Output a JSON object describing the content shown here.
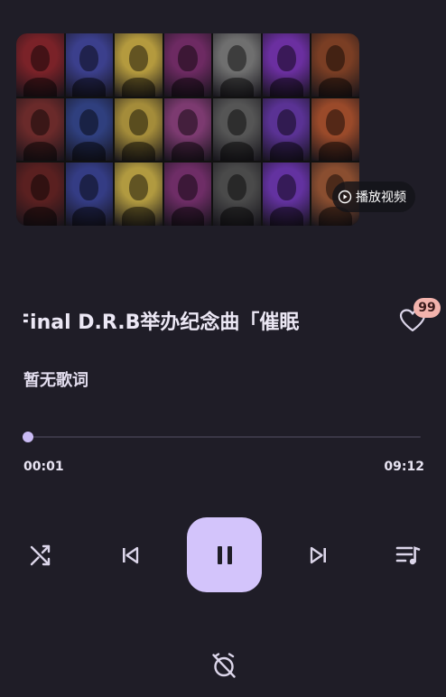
{
  "player": {
    "video_button_label": "播放视频",
    "song_title": "Final D.R.B举办纪念曲「催眠",
    "like_count": "99",
    "lyric_text": "暂无歌词",
    "progress_fraction": 0.002,
    "time_current": "00:01",
    "time_total": "09:12"
  },
  "cover_tiles": [
    "#7a2228",
    "#3b3f8c",
    "#b49a3e",
    "#6d2a62",
    "#6f6f6f",
    "#6b2fa0",
    "#7a3e24",
    "#6a2a2a",
    "#2f3f7e",
    "#a48c3a",
    "#7c3a70",
    "#555555",
    "#5a3294",
    "#9a4a2a",
    "#5a2020",
    "#343c84",
    "#b19a40",
    "#6e2d66",
    "#4a4a4a",
    "#6332a0",
    "#8a4e30"
  ],
  "colors": {
    "accent": "#d3c4fb",
    "background": "#1f1d27",
    "badge": "#f3b3ad"
  }
}
